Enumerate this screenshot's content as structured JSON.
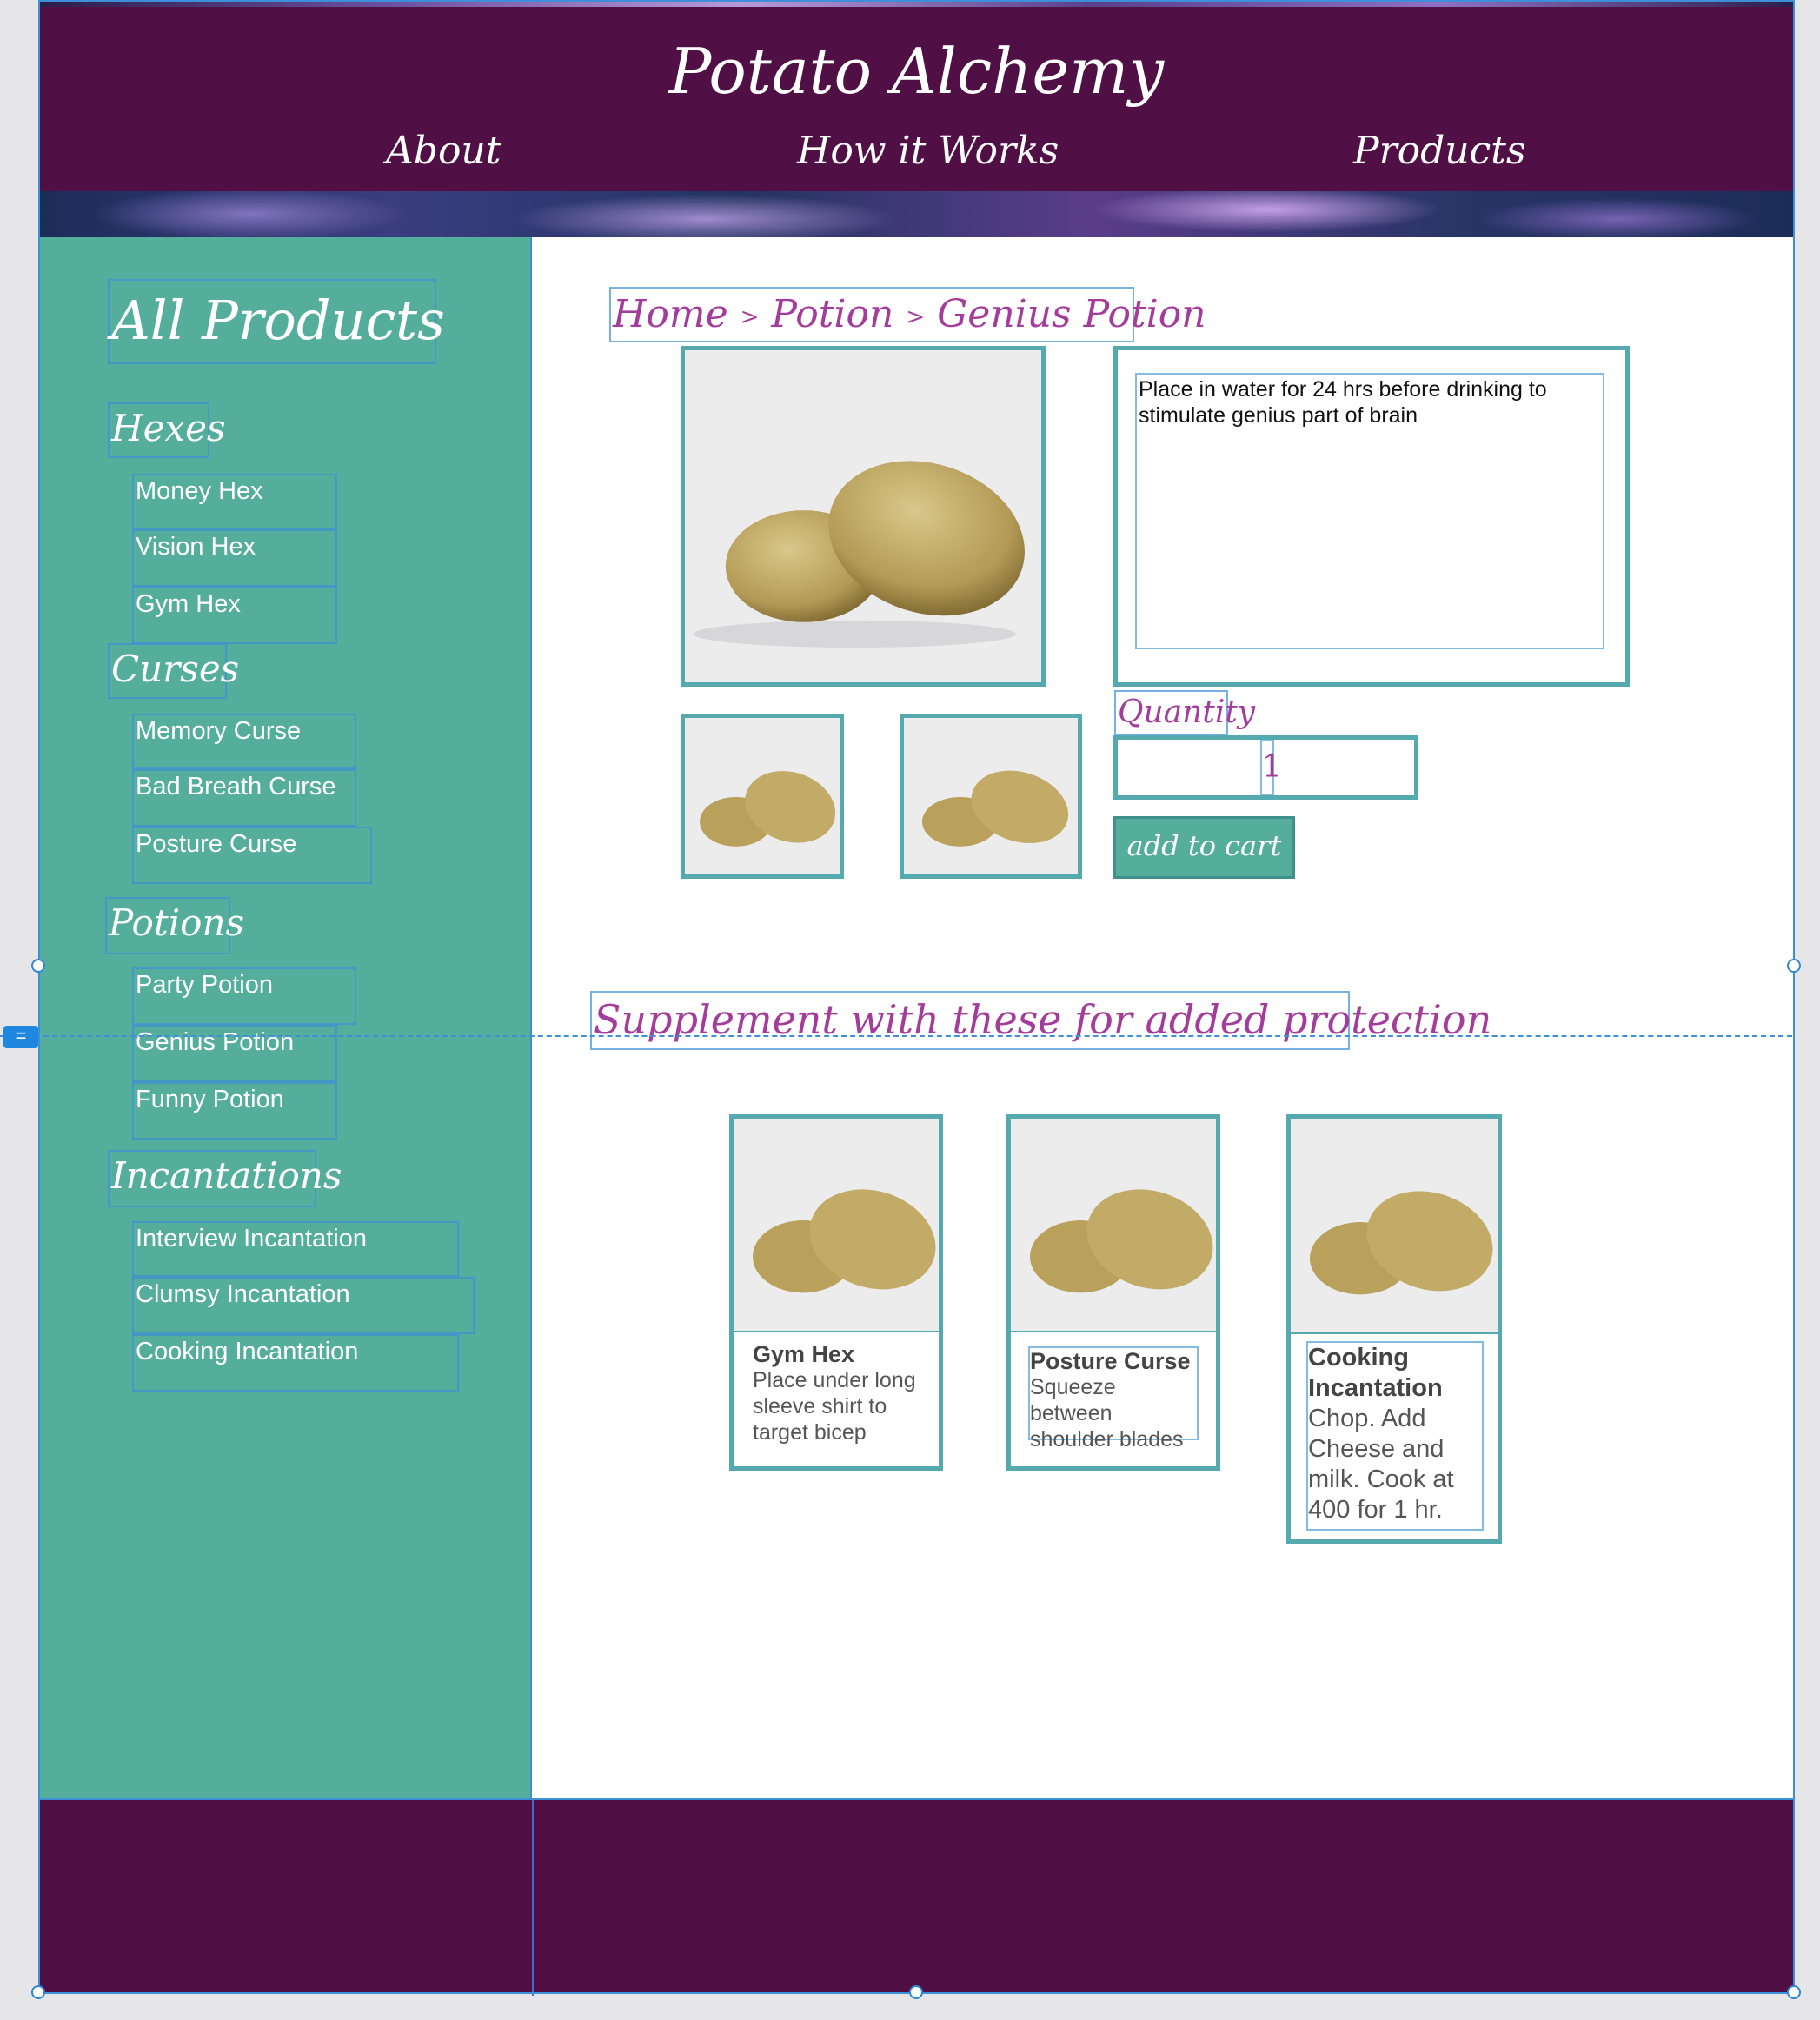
{
  "site": {
    "title": "Potato Alchemy",
    "nav": [
      "About",
      "How it Works",
      "Products"
    ]
  },
  "sidebar": {
    "title": "All Products",
    "categories": [
      {
        "name": "Hexes",
        "items": [
          "Money Hex",
          "Vision Hex",
          "Gym Hex"
        ]
      },
      {
        "name": "Curses",
        "items": [
          "Memory Curse",
          "Bad Breath Curse",
          "Posture Curse"
        ]
      },
      {
        "name": "Potions",
        "items": [
          "Party Potion",
          "Genius Potion",
          "Funny Potion"
        ]
      },
      {
        "name": "Incantations",
        "items": [
          "Interview Incantation",
          "Clumsy Incantation",
          "Cooking Incantation"
        ]
      }
    ]
  },
  "product": {
    "breadcrumb": [
      "Home",
      "Potion",
      "Genius Potion"
    ],
    "breadcrumb_separator": ">",
    "description": "Place in water for 24 hrs before drinking to stimulate genius part of brain",
    "quantity_label": "Quantity",
    "quantity_value": "1",
    "add_to_cart": "add to cart"
  },
  "supplement": {
    "title": "Supplement with these for added protection",
    "cards": [
      {
        "name": "Gym Hex",
        "description": "Place under long sleeve shirt to target bicep"
      },
      {
        "name": "Posture Curse",
        "description": "Squeeze between shoulder blades"
      },
      {
        "name": "Cooking Incantation",
        "description": "Chop. Add Cheese and milk. Cook at 400 for 1 hr."
      }
    ]
  },
  "editor": {
    "guide_tag": "="
  },
  "colors": {
    "header_bg": "#511045",
    "sidebar_bg": "#55ae9c",
    "accent_text": "#a43c9c",
    "frame_border": "#55aab0"
  }
}
